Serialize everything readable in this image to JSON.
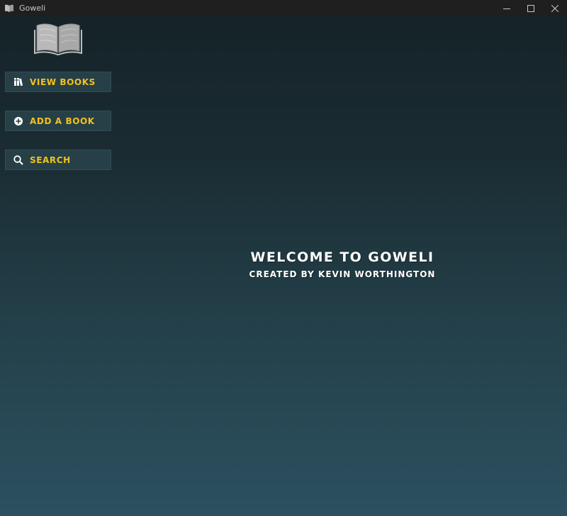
{
  "window": {
    "title": "Goweli"
  },
  "colors": {
    "accent": "#f2c21b",
    "button_bg": "#274048",
    "background_top": "#152227",
    "background_bottom": "#2c5060",
    "titlebar_bg": "#1f1f1f"
  },
  "sidebar": {
    "logo_icon": "open-book-icon",
    "items": [
      {
        "label": "VIEW BOOKS",
        "icon": "books-icon"
      },
      {
        "label": "ADD A BOOK",
        "icon": "plus-circle-icon"
      },
      {
        "label": "SEARCH",
        "icon": "search-icon"
      }
    ]
  },
  "main": {
    "welcome_title": "WELCOME TO GOWELI",
    "welcome_subtitle": "CREATED BY KEVIN WORTHINGTON"
  }
}
